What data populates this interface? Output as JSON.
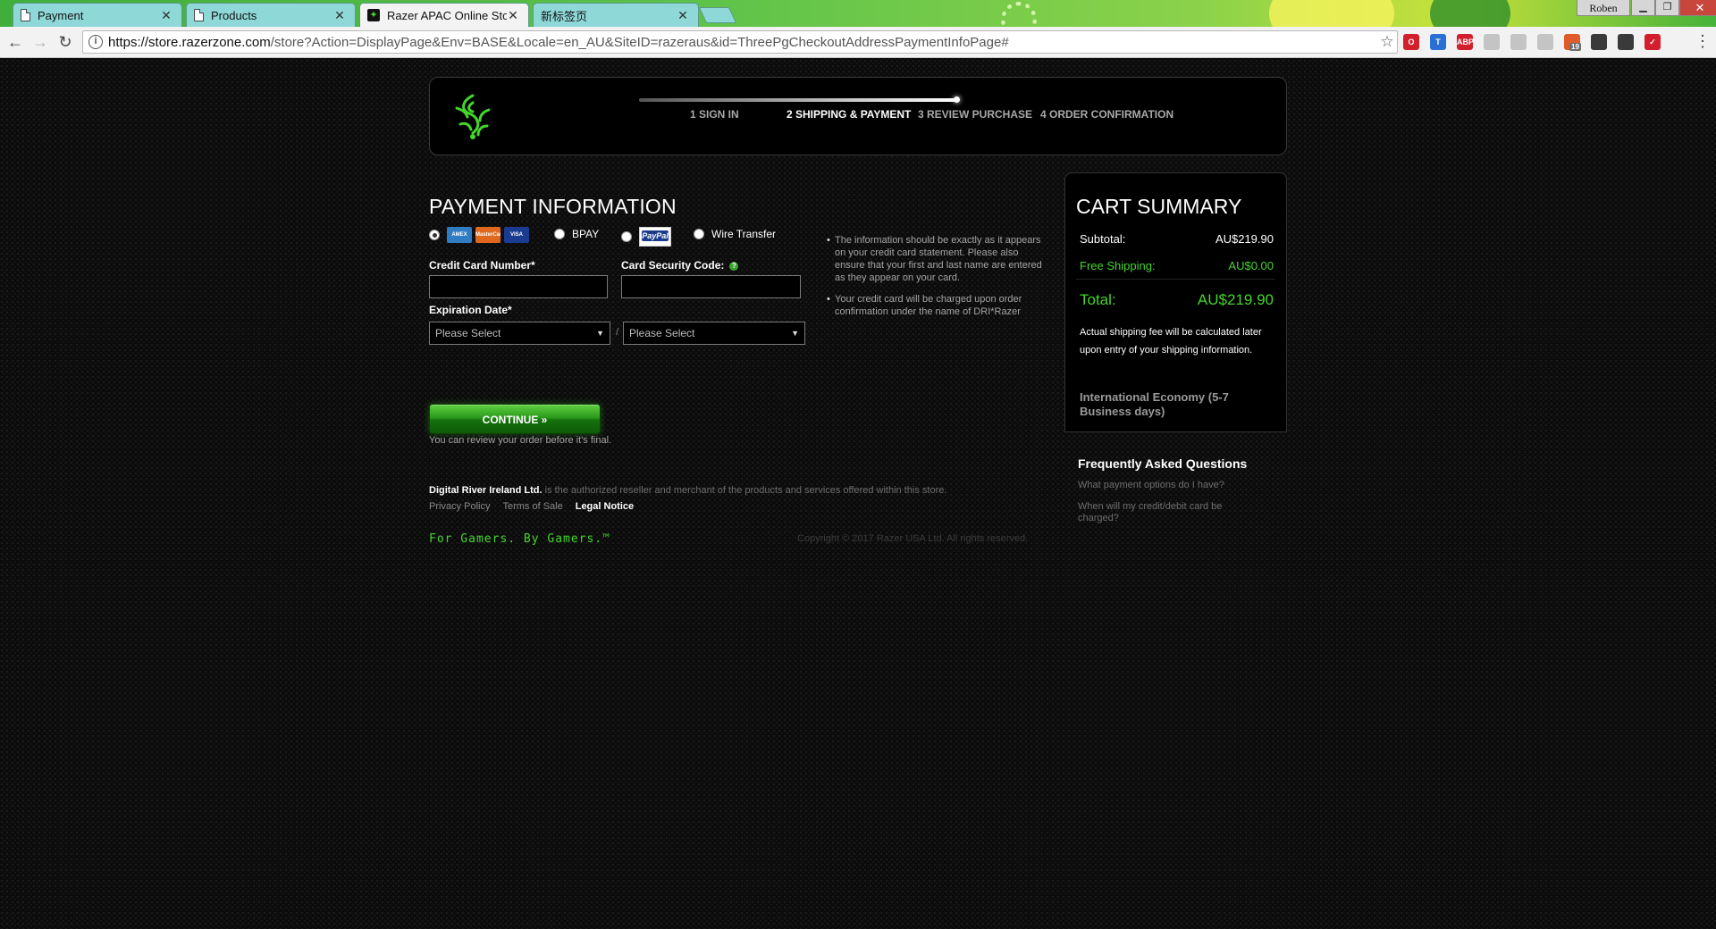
{
  "browser": {
    "tabs": [
      {
        "title": "Payment",
        "active": false
      },
      {
        "title": "Products",
        "active": false
      },
      {
        "title": "Razer APAC Online Sto",
        "active": true
      },
      {
        "title": "新标签页",
        "active": false
      }
    ],
    "user": "Roben",
    "url_host": "https://store.razerzone.com",
    "url_path": "/store?Action=DisplayPage&Env=BASE&Locale=en_AU&SiteID=razeraus&id=ThreePgCheckoutAddressPaymentInfoPage#",
    "extensions": [
      {
        "name": "opera-icon",
        "color": "#d21f2b",
        "label": "O"
      },
      {
        "name": "translate-icon",
        "color": "#2a6fd6",
        "label": "T"
      },
      {
        "name": "adblock-icon",
        "color": "#d21f2b",
        "label": "ABP"
      },
      {
        "name": "extension-gray-icon",
        "color": "#c4c4c4",
        "label": ""
      },
      {
        "name": "rss-icon",
        "color": "#c4c4c4",
        "label": ""
      },
      {
        "name": "extension-gray2-icon",
        "color": "#c4c4c4",
        "label": ""
      },
      {
        "name": "badge-extension-icon",
        "color": "#e05a2a",
        "label": "",
        "badge": "19"
      },
      {
        "name": "evernote-icon",
        "color": "#3a3a3a",
        "label": ""
      },
      {
        "name": "evernote-icon-2",
        "color": "#3a3a3a",
        "label": ""
      },
      {
        "name": "lastpass-icon",
        "color": "#d21f2b",
        "label": "✓"
      }
    ]
  },
  "steps": [
    {
      "label": "1 SIGN IN",
      "current": false
    },
    {
      "label": "2 SHIPPING & PAYMENT",
      "current": true
    },
    {
      "label": "3 REVIEW PURCHASE",
      "current": false
    },
    {
      "label": "4 ORDER CONFIRMATION",
      "current": false
    }
  ],
  "payment": {
    "title": "PAYMENT INFORMATION",
    "methods": {
      "cards": [
        "AMEX",
        "MasterCard",
        "VISA"
      ],
      "bpay": "BPAY",
      "paypal": "PayPal",
      "wire": "Wire Transfer"
    },
    "card_number_label": "Credit Card Number*",
    "security_code_label": "Card Security Code:",
    "expiration_label": "Expiration Date*",
    "month_placeholder": "Please Select",
    "year_placeholder": "Please Select",
    "date_separator": "/",
    "notes": [
      "The information should be exactly as it appears on your credit card statement. Please also ensure that your first and last name are entered as they appear on your card.",
      "Your credit card will be charged upon order confirmation under the name of DRI*Razer"
    ],
    "continue_label": "CONTINUE »",
    "review_note": "You can review your order before it's final."
  },
  "footer": {
    "company": "Digital River Ireland Ltd.",
    "legal_text": " is the authorized reseller and merchant of the products and services offered within this store.",
    "privacy": "Privacy Policy",
    "terms": "Terms of Sale",
    "legal_notice": "Legal Notice",
    "tagline": "For Gamers. By Gamers.™",
    "copyright": "Copyright © 2017 Razer USA Ltd. All rights reserved."
  },
  "cart": {
    "title": "CART SUMMARY",
    "subtotal_label": "Subtotal:",
    "subtotal_value": "AU$219.90",
    "shipping_label": "Free Shipping:",
    "shipping_value": "AU$0.00",
    "total_label": "Total:",
    "total_value": "AU$219.90",
    "shipping_note": "Actual shipping fee will be calculated later upon entry of your shipping information.",
    "shipping_method": "International Economy (5-7 Business days)"
  },
  "faq": {
    "title": "Frequently Asked Questions",
    "q1": "What payment options do I have?",
    "q2": "When will my credit/debit card be charged?"
  },
  "colors": {
    "razer_green": "#44d62c",
    "background": "#0b0b0b"
  }
}
